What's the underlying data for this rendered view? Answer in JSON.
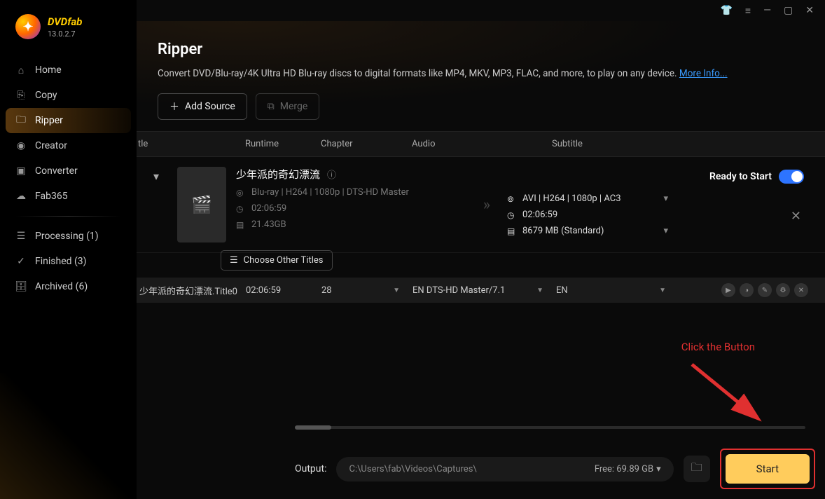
{
  "brand": {
    "name": "DVDfab",
    "version": "13.0.2.7"
  },
  "sidebar": {
    "items": [
      {
        "label": "Home"
      },
      {
        "label": "Copy"
      },
      {
        "label": "Ripper"
      },
      {
        "label": "Creator"
      },
      {
        "label": "Converter"
      },
      {
        "label": "Fab365"
      }
    ],
    "status": [
      {
        "label": "Processing (1)"
      },
      {
        "label": "Finished (3)"
      },
      {
        "label": "Archived (6)"
      }
    ]
  },
  "page": {
    "title": "Ripper",
    "description": "Convert DVD/Blu-ray/4K Ultra HD Blu-ray discs to digital formats like MP4, MKV, MP3, FLAC, and more, to play on any device. ",
    "more_info": "More Info..."
  },
  "toolbar": {
    "add_source": "Add Source",
    "merge": "Merge"
  },
  "columns": {
    "title": "tle",
    "runtime": "Runtime",
    "chapter": "Chapter",
    "audio": "Audio",
    "subtitle": "Subtitle"
  },
  "source": {
    "title": "少年派的奇幻漂流",
    "input_format": "Blu-ray | H264 | 1080p | DTS-HD Master",
    "input_duration": "02:06:59",
    "input_size": "21.43GB",
    "output_format": "AVI | H264 | 1080p | AC3",
    "output_duration": "02:06:59",
    "output_size": "8679 MB (Standard)",
    "status": "Ready to Start",
    "choose_titles": "Choose Other Titles"
  },
  "title_row": {
    "name": "少年派的奇幻漂流.Title0",
    "runtime": "02:06:59",
    "chapter": "28",
    "audio": "EN  DTS-HD Master/7.1",
    "subtitle": "EN"
  },
  "annotation": "Click the Button",
  "footer": {
    "label": "Output:",
    "path": "C:\\Users\\fab\\Videos\\Captures\\",
    "free": "Free: 69.89 GB",
    "start": "Start"
  }
}
